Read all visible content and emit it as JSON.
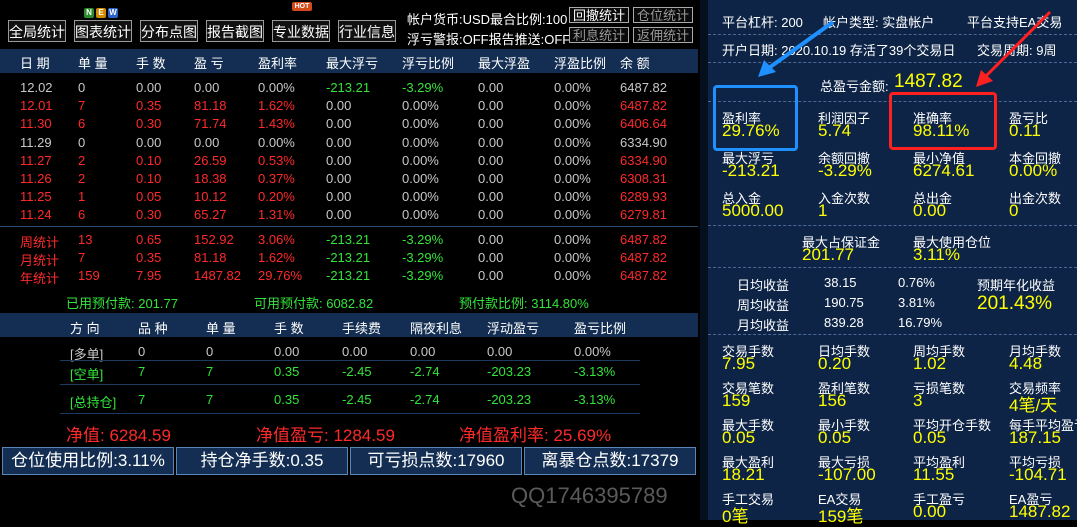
{
  "toolbar": {
    "buttons": [
      "全局统计",
      "图表统计",
      "分布点图",
      "报告截图",
      "专业数据",
      "行业信息"
    ],
    "new_badge": [
      "N",
      "E",
      "W"
    ],
    "hot_badge": "HOT",
    "info_line1": "帐户货币:USD最合比例:100",
    "info_line2": "浮亏警报:OFF报告推送:OFF",
    "small_buttons": [
      "回撤统计",
      "仓位统计",
      "利息统计",
      "返佣统计"
    ]
  },
  "table1": {
    "headers": [
      "日 期",
      "单 量",
      "手 数",
      "盈 亏",
      "盈利率",
      "最大浮亏",
      "浮亏比例",
      "最大浮盈",
      "浮盈比例",
      "余 额"
    ],
    "rows": [
      [
        "12.02",
        "0",
        "0.00",
        "0.00",
        "0.00%",
        "-213.21",
        "-3.29%",
        "0.00",
        "0.00%",
        "6487.82"
      ],
      [
        "12.01",
        "7",
        "0.35",
        "81.18",
        "1.62%",
        "0.00",
        "0.00%",
        "0.00",
        "0.00%",
        "6487.82"
      ],
      [
        "11.30",
        "6",
        "0.30",
        "71.74",
        "1.43%",
        "0.00",
        "0.00%",
        "0.00",
        "0.00%",
        "6406.64"
      ],
      [
        "11.29",
        "0",
        "0.00",
        "0.00",
        "0.00%",
        "0.00",
        "0.00%",
        "0.00",
        "0.00%",
        "6334.90"
      ],
      [
        "11.27",
        "2",
        "0.10",
        "26.59",
        "0.53%",
        "0.00",
        "0.00%",
        "0.00",
        "0.00%",
        "6334.90"
      ],
      [
        "11.26",
        "2",
        "0.10",
        "18.38",
        "0.37%",
        "0.00",
        "0.00%",
        "0.00",
        "0.00%",
        "6308.31"
      ],
      [
        "11.25",
        "1",
        "0.05",
        "10.12",
        "0.20%",
        "0.00",
        "0.00%",
        "0.00",
        "0.00%",
        "6289.93"
      ],
      [
        "11.24",
        "6",
        "0.30",
        "65.27",
        "1.31%",
        "0.00",
        "0.00%",
        "0.00",
        "0.00%",
        "6279.81"
      ]
    ],
    "summary": [
      [
        "周统计",
        "13",
        "0.65",
        "152.92",
        "3.06%",
        "-213.21",
        "-3.29%",
        "0.00",
        "0.00%",
        "6487.82"
      ],
      [
        "月统计",
        "7",
        "0.35",
        "81.18",
        "1.62%",
        "-213.21",
        "-3.29%",
        "0.00",
        "0.00%",
        "6487.82"
      ],
      [
        "年统计",
        "159",
        "7.95",
        "1487.82",
        "29.76%",
        "-213.21",
        "-3.29%",
        "0.00",
        "0.00%",
        "6487.82"
      ]
    ]
  },
  "prepay": {
    "used": "已用预付款: 201.77",
    "available": "可用预付款: 6082.82",
    "ratio": "预付款比例: 3114.80%"
  },
  "table2": {
    "headers": [
      "方 向",
      "品 种",
      "单 量",
      "手 数",
      "手续费",
      "隔夜利息",
      "浮动盈亏",
      "盈亏比例"
    ],
    "rows": [
      [
        "[多单]",
        "0",
        "0",
        "0.00",
        "0.00",
        "0.00",
        "0.00",
        "0.00%"
      ],
      [
        "[空单]",
        "7",
        "7",
        "0.35",
        "-2.45",
        "-2.74",
        "-203.23",
        "-3.13%"
      ],
      [
        "[总持仓]",
        "7",
        "7",
        "0.35",
        "-2.45",
        "-2.74",
        "-203.23",
        "-3.13%"
      ]
    ]
  },
  "net": {
    "value": "净值: 6284.59",
    "pnl": "净值盈亏: 1284.59",
    "rate": "净值盈利率: 25.69%"
  },
  "bottom_boxes": [
    "仓位使用比例:3.11%",
    "持仓净手数:0.35",
    "可亏损点数:17960",
    "离暴仓点数:17379"
  ],
  "watermark": "QQ1746395789",
  "right": {
    "leverage": "平台杠杆: 200",
    "account_type": "帐户类型: 实盘帐户",
    "ea": "平台支持EA交易",
    "open_date": "开户日期: 2020.10.19 存活了39个交易日",
    "trade_weeks": "交易周期: 9周",
    "total_profit_label": "总盈亏金额:",
    "total_profit": "1487.82",
    "grid1": [
      {
        "l": "盈利率",
        "v": "29.76%"
      },
      {
        "l": "利润因子",
        "v": "5.74"
      },
      {
        "l": "准确率",
        "v": "98.11%"
      },
      {
        "l": "盈亏比",
        "v": "0.11"
      },
      {
        "l": "最大浮亏",
        "v": "-213.21"
      },
      {
        "l": "余额回撤",
        "v": "-3.29%"
      },
      {
        "l": "最小净值",
        "v": "6274.61"
      },
      {
        "l": "本金回撤",
        "v": "0.00%"
      },
      {
        "l": "总入金",
        "v": "5000.00"
      },
      {
        "l": "入金次数",
        "v": "1"
      },
      {
        "l": "总出金",
        "v": "0.00"
      },
      {
        "l": "出金次数",
        "v": "0"
      }
    ],
    "margin": [
      {
        "l": "最大占保证金",
        "v": "201.77"
      },
      {
        "l": "最大使用仓位",
        "v": "3.11%"
      }
    ],
    "daily": [
      {
        "l": "日均收益",
        "a": "38.15",
        "b": "0.76%"
      },
      {
        "l": "周均收益",
        "a": "190.75",
        "b": "3.81%"
      },
      {
        "l": "月均收益",
        "a": "839.28",
        "b": "16.79%"
      }
    ],
    "annual_label": "预期年化收益",
    "annual_value": "201.43%",
    "grid2": [
      {
        "l": "交易手数",
        "v": "7.95"
      },
      {
        "l": "日均手数",
        "v": "0.20"
      },
      {
        "l": "周均手数",
        "v": "1.02"
      },
      {
        "l": "月均手数",
        "v": "4.48"
      },
      {
        "l": "交易笔数",
        "v": "159"
      },
      {
        "l": "盈利笔数",
        "v": "156"
      },
      {
        "l": "亏损笔数",
        "v": "3"
      },
      {
        "l": "交易频率",
        "v": "4笔/天"
      },
      {
        "l": "最大手数",
        "v": "0.05"
      },
      {
        "l": "最小手数",
        "v": "0.05"
      },
      {
        "l": "平均开仓手数",
        "v": "0.05"
      },
      {
        "l": "每手平均盈亏",
        "v": "187.15"
      },
      {
        "l": "最大盈利",
        "v": "18.21"
      },
      {
        "l": "最大亏损",
        "v": "-107.00"
      },
      {
        "l": "平均盈利",
        "v": "11.55"
      },
      {
        "l": "平均亏损",
        "v": "-104.71"
      },
      {
        "l": "手工交易",
        "v": "0笔"
      },
      {
        "l": "EA交易",
        "v": "159笔"
      },
      {
        "l": "手工盈亏",
        "v": "0.00"
      },
      {
        "l": "EA盈亏",
        "v": "1487.82"
      }
    ]
  },
  "colors": {
    "panel_bg": "#0d2447",
    "header_bg": "#132e52",
    "blue_box": "#1e90ff",
    "red_box": "#ff2020",
    "profit_red": "#ff2a2a",
    "loss_green": "#33e43a",
    "value_yellow": "#ffff00"
  }
}
